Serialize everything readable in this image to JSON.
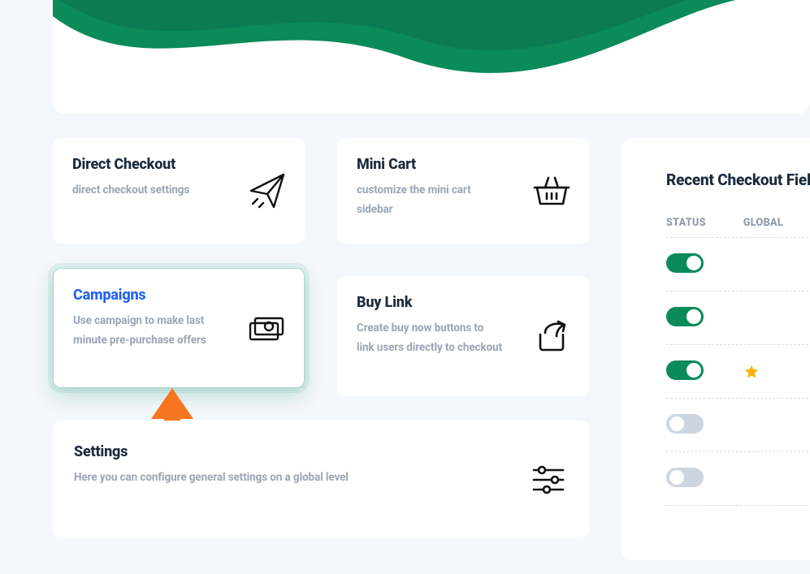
{
  "colors": {
    "accent_green": "#0b8a5a",
    "accent_link": "#2563eb",
    "pointer": "#f7751e",
    "star": "#f5b50a"
  },
  "cards": {
    "direct_checkout": {
      "title": "Direct Checkout",
      "desc": "direct checkout settings"
    },
    "mini_cart": {
      "title": "Mini Cart",
      "desc": "customize the mini cart sidebar"
    },
    "campaigns": {
      "title": "Campaigns",
      "desc": "Use campaign to make last minute pre-purchase offers"
    },
    "buy_link": {
      "title": "Buy Link",
      "desc": "Create buy now buttons to link users directly to checkout"
    },
    "settings": {
      "title": "Settings",
      "desc": "Here you can configure general settings on a global level"
    }
  },
  "sidebar": {
    "title": "Recent Checkout Fields",
    "columns": {
      "status": "STATUS",
      "global": "GLOBAL"
    },
    "rows": [
      {
        "status_on": true,
        "star": false
      },
      {
        "status_on": true,
        "star": false
      },
      {
        "status_on": true,
        "star": true
      },
      {
        "status_on": false,
        "star": false
      },
      {
        "status_on": false,
        "star": false
      }
    ]
  }
}
